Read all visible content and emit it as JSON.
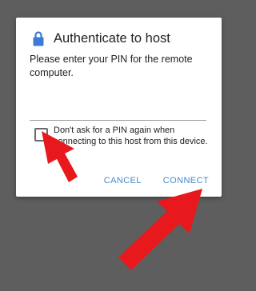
{
  "dialog": {
    "title": "Authenticate to host",
    "lock_icon": "lock-icon",
    "message": "Please enter your PIN for the remote computer.",
    "pin_value": "",
    "remember_label": "Don't ask for a PIN again when connecting to this host from this device.",
    "remember_checked": false,
    "cancel_label": "CANCEL",
    "connect_label": "CONNECT"
  },
  "colors": {
    "backdrop": "#5e5e5e",
    "accent": "#4a8ac8",
    "lock": "#3b7bd4",
    "annotation_arrow": "#e8191c"
  }
}
